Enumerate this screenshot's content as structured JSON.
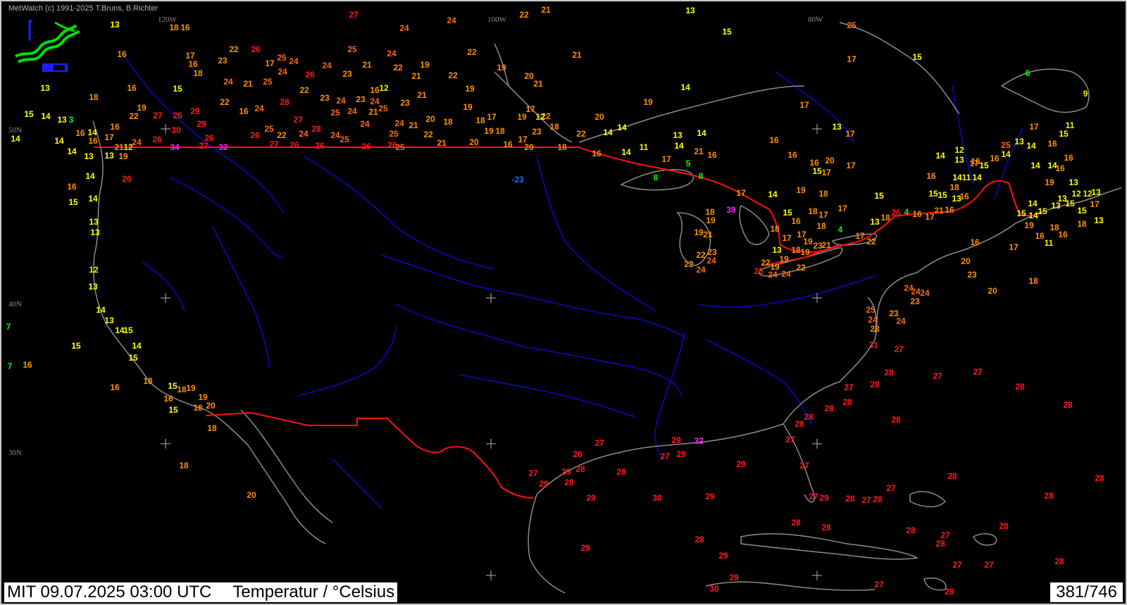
{
  "header": {
    "copyright": "MetWatch  (c) 1991-2025 T.Bruns, B.Richter"
  },
  "logo": {
    "icon": "metwatch-logo-icon"
  },
  "footer": {
    "valid_time": "MIT 09.07.2025 03:00 UTC",
    "parameter": "Temperatur / °Celsius",
    "frame_counter": "381/746"
  },
  "grid_labels": {
    "lon": [
      "120W",
      "100W",
      "80W"
    ],
    "lat": [
      "50N",
      "40N",
      "30N"
    ]
  },
  "colors": {
    "background": "#000000",
    "coastline": "#8c8c8c",
    "rivers": "#0a0ac8",
    "borders": "#ff1010",
    "grid_cross": "#b4b4b4",
    "t_le_8": "#00ff00",
    "t_9_12": "#f0f000",
    "t_13_15": "#ffff00",
    "t_16_23": "#ff9000",
    "t_24_25": "#ff6a10",
    "t_26_31": "#ff1a1a",
    "t_32_plus": "#ff20ff",
    "t_negative": "#1a6aff"
  },
  "observations": [
    [
      "13",
      161,
      33
    ],
    [
      "18",
      245,
      37
    ],
    [
      "16",
      261,
      37
    ],
    [
      "27",
      500,
      19
    ],
    [
      "24",
      572,
      38
    ],
    [
      "24",
      639,
      27
    ],
    [
      "22",
      742,
      19
    ],
    [
      "21",
      773,
      12
    ],
    [
      "13",
      978,
      13
    ],
    [
      "15",
      1030,
      43
    ],
    [
      "25",
      1207,
      34
    ],
    [
      "16",
      171,
      75
    ],
    [
      "17",
      268,
      77
    ],
    [
      "16",
      272,
      89
    ],
    [
      "18",
      279,
      102
    ],
    [
      "23",
      314,
      84
    ],
    [
      "22",
      330,
      68
    ],
    [
      "26",
      361,
      68
    ],
    [
      "17",
      381,
      88
    ],
    [
      "25",
      398,
      80
    ],
    [
      "24",
      415,
      85
    ],
    [
      "24",
      399,
      100
    ],
    [
      "26",
      438,
      104
    ],
    [
      "24",
      462,
      91
    ],
    [
      "25",
      498,
      68
    ],
    [
      "24",
      554,
      74
    ],
    [
      "22",
      668,
      72
    ],
    [
      "21",
      519,
      90
    ],
    [
      "23",
      491,
      103
    ],
    [
      "22",
      563,
      94
    ],
    [
      "19",
      601,
      90
    ],
    [
      "21",
      589,
      106
    ],
    [
      "22",
      641,
      105
    ],
    [
      "19",
      710,
      94
    ],
    [
      "20",
      749,
      106
    ],
    [
      "21",
      762,
      117
    ],
    [
      "21",
      817,
      76
    ],
    [
      "17",
      1207,
      82
    ],
    [
      "15",
      1300,
      79
    ],
    [
      "6",
      1457,
      102
    ],
    [
      "9",
      1539,
      131
    ],
    [
      "13",
      62,
      123
    ],
    [
      "18",
      131,
      136
    ],
    [
      "16",
      185,
      123
    ],
    [
      "15",
      250,
      124
    ],
    [
      "24",
      322,
      114
    ],
    [
      "21",
      350,
      117
    ],
    [
      "25",
      378,
      114
    ],
    [
      "22",
      430,
      126
    ],
    [
      "28",
      402,
      143
    ],
    [
      "23",
      459,
      137
    ],
    [
      "24",
      482,
      141
    ],
    [
      "23",
      510,
      139
    ],
    [
      "24",
      530,
      142
    ],
    [
      "16",
      530,
      126
    ],
    [
      "12",
      543,
      123
    ],
    [
      "25",
      542,
      152
    ],
    [
      "23",
      573,
      144
    ],
    [
      "21",
      597,
      133
    ],
    [
      "19",
      665,
      124
    ],
    [
      "22",
      317,
      143
    ],
    [
      "16",
      344,
      156
    ],
    [
      "24",
      366,
      152
    ],
    [
      "22",
      188,
      163
    ],
    [
      "19",
      199,
      151
    ],
    [
      "27",
      222,
      162
    ],
    [
      "26",
      250,
      162
    ],
    [
      "29",
      275,
      156
    ],
    [
      "30",
      248,
      183
    ],
    [
      "29",
      284,
      174
    ],
    [
      "15",
      39,
      160
    ],
    [
      "14",
      63,
      163
    ],
    [
      "13",
      86,
      168
    ],
    [
      "3",
      99,
      168
    ],
    [
      "16",
      112,
      187
    ],
    [
      "14",
      129,
      186
    ],
    [
      "17",
      153,
      193
    ],
    [
      "16",
      161,
      178
    ],
    [
      "14",
      20,
      195
    ],
    [
      "14",
      82,
      198
    ],
    [
      "14",
      100,
      213
    ],
    [
      "16",
      130,
      198
    ],
    [
      "12",
      180,
      207
    ],
    [
      "21",
      167,
      207
    ],
    [
      "24",
      192,
      200
    ],
    [
      "26",
      221,
      196
    ],
    [
      "34",
      246,
      207
    ],
    [
      "27",
      287,
      205
    ],
    [
      "32",
      315,
      207
    ],
    [
      "26",
      295,
      194
    ],
    [
      "26",
      360,
      190
    ],
    [
      "25",
      380,
      181
    ],
    [
      "22",
      398,
      190
    ],
    [
      "24",
      429,
      188
    ],
    [
      "28",
      447,
      181
    ],
    [
      "27",
      421,
      168
    ],
    [
      "25",
      474,
      158
    ],
    [
      "24",
      498,
      156
    ],
    [
      "21",
      528,
      157
    ],
    [
      "24",
      516,
      174
    ],
    [
      "24",
      565,
      173
    ],
    [
      "21",
      585,
      176
    ],
    [
      "20",
      609,
      167
    ],
    [
      "25",
      557,
      188
    ],
    [
      "22",
      606,
      189
    ],
    [
      "24",
      474,
      190
    ],
    [
      "25",
      487,
      196
    ],
    [
      "27",
      387,
      203
    ],
    [
      "26",
      416,
      204
    ],
    [
      "26",
      452,
      205
    ],
    [
      "26",
      518,
      206
    ],
    [
      "26",
      555,
      204
    ],
    [
      "25",
      566,
      207
    ],
    [
      "21",
      625,
      201
    ],
    [
      "20",
      671,
      200
    ],
    [
      "18",
      634,
      171
    ],
    [
      "19",
      662,
      150
    ],
    [
      "18",
      680,
      169
    ],
    [
      "17",
      696,
      164
    ],
    [
      "19",
      692,
      184
    ],
    [
      "18",
      708,
      184
    ],
    [
      "19",
      739,
      164
    ],
    [
      "17",
      751,
      153
    ],
    [
      "22",
      773,
      163
    ],
    [
      "12",
      765,
      164
    ],
    [
      "23",
      760,
      185
    ],
    [
      "18",
      785,
      178
    ],
    [
      "17",
      740,
      196
    ],
    [
      "16",
      719,
      203
    ],
    [
      "20",
      749,
      207
    ],
    [
      "18",
      796,
      207
    ],
    [
      "22",
      823,
      188
    ],
    [
      "20",
      849,
      164
    ],
    [
      "14",
      861,
      186
    ],
    [
      "14",
      881,
      179
    ],
    [
      "19",
      918,
      143
    ],
    [
      "14",
      971,
      122
    ],
    [
      "17",
      1140,
      147
    ],
    [
      "13",
      1186,
      178
    ],
    [
      "17",
      1205,
      188
    ],
    [
      "13",
      124,
      220
    ],
    [
      "13",
      153,
      219
    ],
    [
      "19",
      173,
      220
    ],
    [
      "26",
      178,
      252
    ],
    [
      "16",
      845,
      216
    ],
    [
      "14",
      887,
      214
    ],
    [
      "11",
      912,
      207
    ],
    [
      "17",
      944,
      224
    ],
    [
      "13",
      960,
      190
    ],
    [
      "14",
      962,
      205
    ],
    [
      "14",
      994,
      187
    ],
    [
      "21",
      990,
      213
    ],
    [
      "16",
      1009,
      218
    ],
    [
      "5",
      975,
      230
    ],
    [
      "8",
      929,
      250
    ],
    [
      "8",
      993,
      248
    ],
    [
      "16",
      1097,
      197
    ],
    [
      "16",
      1123,
      218
    ],
    [
      "16",
      1154,
      229
    ],
    [
      "15",
      1158,
      241
    ],
    [
      "17",
      1171,
      243
    ],
    [
      "20",
      1176,
      226
    ],
    [
      "17",
      1206,
      233
    ],
    [
      "14",
      1333,
      219
    ],
    [
      "12",
      1360,
      211
    ],
    [
      "13",
      1360,
      225
    ],
    [
      "16",
      1383,
      227
    ],
    [
      "17",
      1381,
      230
    ],
    [
      "15",
      1395,
      233
    ],
    [
      "16",
      1410,
      223
    ],
    [
      "14",
      1426,
      217
    ],
    [
      "25",
      1426,
      204
    ],
    [
      "13",
      1445,
      199
    ],
    [
      "14",
      1462,
      205
    ],
    [
      "16",
      1492,
      202
    ],
    [
      "17",
      1466,
      178
    ],
    [
      "11",
      1517,
      176
    ],
    [
      "15",
      1508,
      188
    ],
    [
      "14",
      1468,
      233
    ],
    [
      "14",
      1492,
      233
    ],
    [
      "16",
      1503,
      237
    ],
    [
      "16",
      1515,
      222
    ],
    [
      "-23",
      733,
      253
    ],
    [
      "14",
      126,
      248
    ],
    [
      "16",
      100,
      263
    ],
    [
      "15",
      102,
      285
    ],
    [
      "14",
      130,
      280
    ],
    [
      "13",
      131,
      313
    ],
    [
      "13",
      133,
      328
    ],
    [
      "12",
      131,
      381
    ],
    [
      "13",
      130,
      405
    ],
    [
      "14",
      141,
      438
    ],
    [
      "13",
      153,
      453
    ],
    [
      "14",
      168,
      467
    ],
    [
      "15",
      180,
      467
    ],
    [
      "14",
      192,
      489
    ],
    [
      "15",
      187,
      506
    ],
    [
      "15",
      106,
      489
    ],
    [
      "16",
      37,
      516
    ],
    [
      "7",
      10,
      462
    ],
    [
      "7",
      12,
      518
    ],
    [
      "16",
      161,
      548
    ],
    [
      "18",
      208,
      539
    ],
    [
      "15",
      243,
      546
    ],
    [
      "18",
      256,
      551
    ],
    [
      "19",
      269,
      549
    ],
    [
      "16",
      237,
      564
    ],
    [
      "19",
      286,
      562
    ],
    [
      "20",
      297,
      574
    ],
    [
      "15",
      244,
      580
    ],
    [
      "18",
      279,
      577
    ],
    [
      "18",
      299,
      606
    ],
    [
      "18",
      259,
      659
    ],
    [
      "20",
      355,
      701
    ],
    [
      "17",
      1050,
      272
    ],
    [
      "14",
      1095,
      274
    ],
    [
      "19",
      1135,
      268
    ],
    [
      "18",
      1167,
      273
    ],
    [
      "15",
      1246,
      276
    ],
    [
      "17",
      1194,
      294
    ],
    [
      "15",
      1116,
      300
    ],
    [
      "16",
      1128,
      312
    ],
    [
      "18",
      1152,
      298
    ],
    [
      "17",
      1167,
      303
    ],
    [
      "18",
      1164,
      319
    ],
    [
      "13",
      1240,
      313
    ],
    [
      "18",
      1255,
      307
    ],
    [
      "26",
      1270,
      300
    ],
    [
      "4",
      1285,
      299
    ],
    [
      "16",
      1300,
      302
    ],
    [
      "17",
      1318,
      306
    ],
    [
      "21",
      1331,
      297
    ],
    [
      "16",
      1346,
      296
    ],
    [
      "13",
      1356,
      280
    ],
    [
      "16",
      1367,
      277
    ],
    [
      "15",
      1323,
      273
    ],
    [
      "15",
      1336,
      275
    ],
    [
      "18",
      1353,
      264
    ],
    [
      "16",
      1320,
      248
    ],
    [
      "14",
      1357,
      250
    ],
    [
      "11",
      1370,
      250
    ],
    [
      "14",
      1385,
      250
    ],
    [
      "19",
      1488,
      257
    ],
    [
      "13",
      1522,
      257
    ],
    [
      "14",
      1464,
      287
    ],
    [
      "15",
      1478,
      298
    ],
    [
      "13",
      1497,
      290
    ],
    [
      "15",
      1517,
      287
    ],
    [
      "13",
      1506,
      280
    ],
    [
      "12",
      1526,
      273
    ],
    [
      "12",
      1542,
      273
    ],
    [
      "13",
      1554,
      271
    ],
    [
      "17",
      1552,
      288
    ],
    [
      "15",
      1534,
      297
    ],
    [
      "15",
      1448,
      301
    ],
    [
      "14",
      1465,
      304
    ],
    [
      "19",
      1459,
      318
    ],
    [
      "16",
      1474,
      333
    ],
    [
      "18",
      1495,
      321
    ],
    [
      "18",
      1534,
      316
    ],
    [
      "16",
      1507,
      331
    ],
    [
      "13",
      1558,
      311
    ],
    [
      "11",
      1487,
      343
    ],
    [
      "16",
      1382,
      342
    ],
    [
      "17",
      1437,
      349
    ],
    [
      "20",
      1369,
      369
    ],
    [
      "23",
      1378,
      388
    ],
    [
      "20",
      1407,
      411
    ],
    [
      "18",
      1465,
      397
    ],
    [
      "18",
      1006,
      299
    ],
    [
      "39",
      1036,
      296
    ],
    [
      "19",
      1007,
      311
    ],
    [
      "19",
      990,
      328
    ],
    [
      "21",
      1003,
      331
    ],
    [
      "22",
      993,
      360
    ],
    [
      "23",
      1009,
      356
    ],
    [
      "24",
      1008,
      368
    ],
    [
      "22",
      976,
      373
    ],
    [
      "24",
      993,
      381
    ],
    [
      "18",
      1098,
      323
    ],
    [
      "17",
      1115,
      336
    ],
    [
      "17",
      1136,
      331
    ],
    [
      "13",
      1101,
      353
    ],
    [
      "19",
      1111,
      366
    ],
    [
      "18",
      1128,
      353
    ],
    [
      "19",
      1141,
      356
    ],
    [
      "19",
      1145,
      341
    ],
    [
      "23",
      1159,
      347
    ],
    [
      "21",
      1171,
      346
    ],
    [
      "4",
      1191,
      324
    ],
    [
      "17",
      1219,
      333
    ],
    [
      "22",
      1235,
      341
    ],
    [
      "22",
      1085,
      371
    ],
    [
      "19",
      1098,
      377
    ],
    [
      "26",
      1075,
      383
    ],
    [
      "24",
      1095,
      388
    ],
    [
      "24",
      1114,
      387
    ],
    [
      "22",
      1135,
      378
    ],
    [
      "24",
      1288,
      407
    ],
    [
      "24",
      1298,
      412
    ],
    [
      "24",
      1311,
      414
    ],
    [
      "23",
      1297,
      426
    ],
    [
      "23",
      1267,
      443
    ],
    [
      "24",
      1277,
      454
    ],
    [
      "25",
      1234,
      438
    ],
    [
      "24",
      1237,
      452
    ],
    [
      "23",
      1240,
      465
    ],
    [
      "31",
      1238,
      488
    ],
    [
      "27",
      1274,
      494
    ],
    [
      "28",
      1260,
      527
    ],
    [
      "27",
      1329,
      532
    ],
    [
      "27",
      1386,
      526
    ],
    [
      "28",
      1240,
      544
    ],
    [
      "27",
      1203,
      548
    ],
    [
      "28",
      1446,
      547
    ],
    [
      "28",
      1201,
      569
    ],
    [
      "28",
      1175,
      578
    ],
    [
      "28",
      1146,
      590
    ],
    [
      "28",
      1133,
      600
    ],
    [
      "28",
      1270,
      594
    ],
    [
      "28",
      1514,
      573
    ],
    [
      "27",
      1120,
      622
    ],
    [
      "27",
      1140,
      659
    ],
    [
      "29",
      958,
      623
    ],
    [
      "32",
      990,
      624
    ],
    [
      "27",
      849,
      627
    ],
    [
      "27",
      942,
      646
    ],
    [
      "29",
      965,
      643
    ],
    [
      "26",
      818,
      643
    ],
    [
      "29",
      1050,
      657
    ],
    [
      "27",
      755,
      670
    ],
    [
      "29",
      802,
      668
    ],
    [
      "28",
      822,
      664
    ],
    [
      "28",
      880,
      668
    ],
    [
      "29",
      770,
      685
    ],
    [
      "28",
      806,
      683
    ],
    [
      "29",
      837,
      705
    ],
    [
      "30",
      931,
      705
    ],
    [
      "29",
      1006,
      703
    ],
    [
      "27",
      1153,
      703
    ],
    [
      "29",
      1168,
      705
    ],
    [
      "28",
      1205,
      706
    ],
    [
      "27",
      1228,
      708
    ],
    [
      "28",
      1244,
      707
    ],
    [
      "27",
      1263,
      691
    ],
    [
      "28",
      1350,
      674
    ],
    [
      "28",
      1559,
      677
    ],
    [
      "28",
      1487,
      702
    ],
    [
      "28",
      1128,
      740
    ],
    [
      "28",
      1171,
      747
    ],
    [
      "28",
      1291,
      751
    ],
    [
      "27",
      1340,
      758
    ],
    [
      "28",
      1333,
      770
    ],
    [
      "28",
      1423,
      745
    ],
    [
      "28",
      991,
      764
    ],
    [
      "29",
      829,
      776
    ],
    [
      "29",
      1025,
      787
    ],
    [
      "27",
      1357,
      800
    ],
    [
      "27",
      1402,
      800
    ],
    [
      "28",
      1502,
      795
    ],
    [
      "29",
      1040,
      818
    ],
    [
      "27",
      1246,
      828
    ],
    [
      "30",
      1012,
      834
    ],
    [
      "28",
      1346,
      838
    ]
  ]
}
